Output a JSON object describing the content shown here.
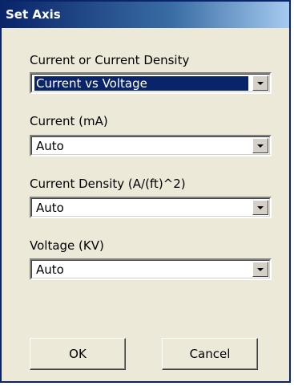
{
  "window": {
    "title": "Set Axis"
  },
  "fields": {
    "mode": {
      "label": "Current or Current Density",
      "value": "Current vs Voltage"
    },
    "current": {
      "label": "Current (mA)",
      "value": "Auto"
    },
    "current_density": {
      "label": "Current Density (A/(ft)^2)",
      "value": "Auto"
    },
    "voltage": {
      "label": "Voltage (KV)",
      "value": "Auto"
    }
  },
  "buttons": {
    "ok": "OK",
    "cancel": "Cancel"
  },
  "icons": {
    "dropdown": "chevron-down-icon"
  },
  "colors": {
    "title_bar": "#0a246a",
    "dialog_bg": "#ece9d8",
    "selection": "#0a246a"
  }
}
